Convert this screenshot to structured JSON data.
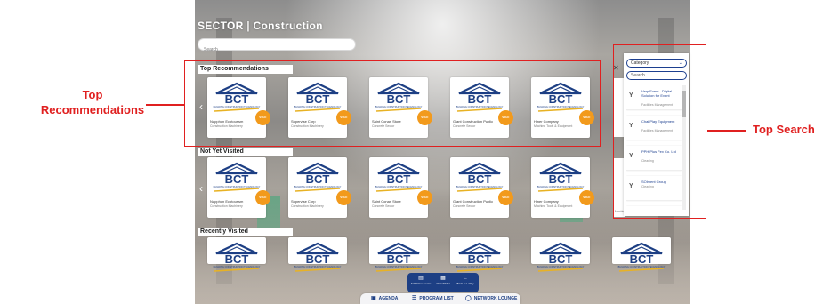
{
  "sector": {
    "prefix": "SECTOR",
    "separator": "|",
    "name": "Construction"
  },
  "search": {
    "placeholder": "Search"
  },
  "sections": {
    "top_recommendations": "Top Recommendations",
    "not_yet_visited": "Not Yet Visited",
    "recently_visited": "Recently Visited"
  },
  "logo_text": {
    "main": "BCT",
    "sub": "BUILDING CONSTRUCTION TECHNOLOGY"
  },
  "visit_label": "VISIT",
  "rows": {
    "top": [
      {
        "name": "Napphon Ecotourism",
        "category": "Construction Machinery"
      },
      {
        "name": "Supervise Corp",
        "category": "Construction Machinery"
      },
      {
        "name": "Saint Conan Store",
        "category": "Concrete Sector"
      },
      {
        "name": "Giant Construction Public",
        "category": "Concrete Sector"
      },
      {
        "name": "Hiner Company",
        "category": "Machine Tools & Equipment"
      }
    ],
    "notyet": [
      {
        "name": "Napphon Ecotourism",
        "category": "Construction Machinery"
      },
      {
        "name": "Supervise Corp",
        "category": "Construction Machinery"
      },
      {
        "name": "Saint Conan Store",
        "category": "Concrete Sector"
      },
      {
        "name": "Giant Construction Public",
        "category": "Concrete Sector"
      },
      {
        "name": "Hiner Company",
        "category": "Machine Tools & Equipment"
      }
    ],
    "notyet_peek_category": "Machine Tools & Equipment"
  },
  "panel": {
    "category_label": "Category",
    "search_placeholder": "Search",
    "results": [
      {
        "name": "Varp Event - Digital Solution for Event",
        "category": "Facilities Management"
      },
      {
        "name": "Chai Play Equipment",
        "category": "Facilities Management"
      },
      {
        "name": "PPH Plus Fex Co. Ltd",
        "category": "Cleaning"
      },
      {
        "name": "SOlment Group",
        "category": "Cleaning"
      },
      {
        "name": "FTP Custom Tailor Chang Rai",
        "category": "Uniform"
      }
    ]
  },
  "annotations": {
    "top_recommendations": "Top\nRecommendations",
    "top_search": "Top Search"
  },
  "dock": [
    {
      "label": "Exhibition Sector",
      "icon": "▤"
    },
    {
      "label": "All Exhibitor",
      "icon": "▦"
    },
    {
      "label": "Back to Lobby",
      "icon": "←"
    }
  ],
  "bottom_bar": [
    {
      "label": "AGENDA",
      "icon": "▣"
    },
    {
      "label": "PROGRAM LIST",
      "icon": "☰"
    },
    {
      "label": "NETWORK LOUNGE",
      "icon": "◯"
    }
  ],
  "colors": {
    "accent": "#1d3f84",
    "visit": "#f29a1c",
    "annotation": "#e02020",
    "logo_gold": "#e8b224"
  }
}
